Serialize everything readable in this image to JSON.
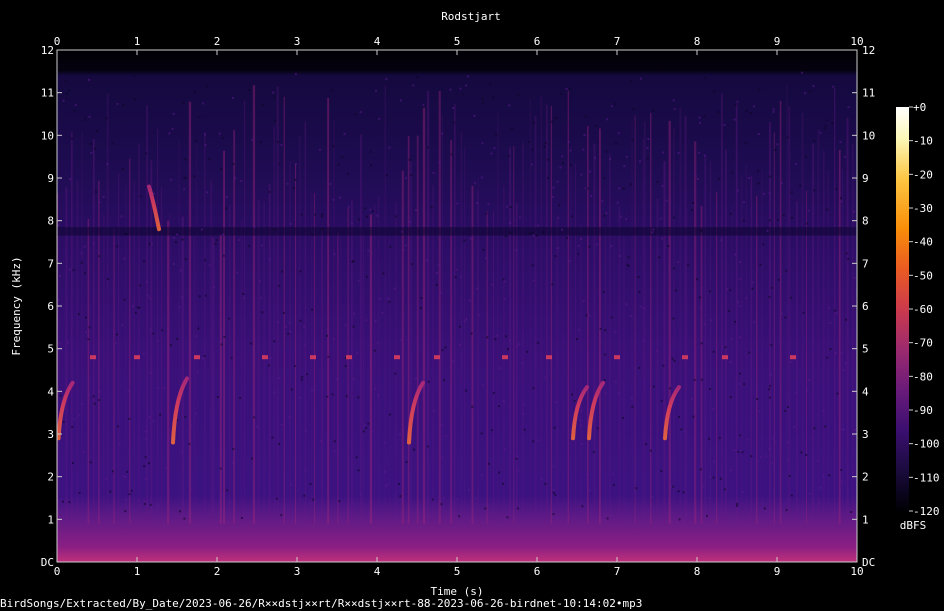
{
  "chart_data": {
    "type": "heatmap",
    "title": "Rodstjart",
    "xlabel": "Time (s)",
    "ylabel": "Frequency (kHz)",
    "xlim": [
      0,
      10
    ],
    "ylim": [
      0,
      12
    ],
    "x_ticks": [
      "0",
      "1",
      "2",
      "3",
      "4",
      "5",
      "6",
      "7",
      "8",
      "9",
      "10"
    ],
    "y_ticks": [
      "DC",
      "1",
      "2",
      "3",
      "4",
      "5",
      "6",
      "7",
      "8",
      "9",
      "10",
      "11",
      "12"
    ],
    "colorbar": {
      "label": "dBFS",
      "range": [
        -120,
        0
      ],
      "ticks": [
        "+0",
        "-10",
        "-20",
        "-30",
        "-40",
        "-50",
        "-60",
        "-70",
        "-80",
        "-90",
        "-100",
        "-110",
        "-120"
      ],
      "colors": [
        "#000004",
        "#1a0b3d",
        "#3b0f70",
        "#6a1b7a",
        "#9c2a6e",
        "#cc3a4c",
        "#ea5b22",
        "#f98e09",
        "#fcc541",
        "#fcf6b5",
        "#ffffff"
      ]
    },
    "dominant_band_khz": [
      0,
      1
    ],
    "noise_ceiling_khz": 11.5,
    "calls": [
      {
        "time_s": 0.02,
        "freq_start_khz": 2.9,
        "freq_end_khz": 4.2
      },
      {
        "time_s": 1.15,
        "freq_start_khz": 8.8,
        "freq_end_khz": 7.8
      },
      {
        "time_s": 1.45,
        "freq_start_khz": 2.8,
        "freq_end_khz": 4.3
      },
      {
        "time_s": 4.4,
        "freq_start_khz": 2.8,
        "freq_end_khz": 4.2
      },
      {
        "time_s": 6.45,
        "freq_start_khz": 2.9,
        "freq_end_khz": 4.1
      },
      {
        "time_s": 6.65,
        "freq_start_khz": 2.9,
        "freq_end_khz": 4.2
      },
      {
        "time_s": 7.6,
        "freq_start_khz": 2.9,
        "freq_end_khz": 4.1
      }
    ],
    "tones": [
      {
        "time_s": 0.45,
        "freq_khz": 4.8
      },
      {
        "time_s": 1.0,
        "freq_khz": 4.8
      },
      {
        "time_s": 1.75,
        "freq_khz": 4.8
      },
      {
        "time_s": 2.6,
        "freq_khz": 4.8
      },
      {
        "time_s": 3.2,
        "freq_khz": 4.8
      },
      {
        "time_s": 3.65,
        "freq_khz": 4.8
      },
      {
        "time_s": 4.25,
        "freq_khz": 4.8
      },
      {
        "time_s": 4.75,
        "freq_khz": 4.8
      },
      {
        "time_s": 5.6,
        "freq_khz": 4.8
      },
      {
        "time_s": 6.15,
        "freq_khz": 4.8
      },
      {
        "time_s": 7.0,
        "freq_khz": 4.8
      },
      {
        "time_s": 7.85,
        "freq_khz": 4.8
      },
      {
        "time_s": 8.35,
        "freq_khz": 4.8
      },
      {
        "time_s": 9.2,
        "freq_khz": 4.8
      }
    ]
  },
  "footer": {
    "file_path": "BirdSongs/Extracted/By_Date/2023-06-26/R××dstj××rt/R××dstj××rt-88-2023-06-26-birdnet-10:14:02•mp3"
  }
}
